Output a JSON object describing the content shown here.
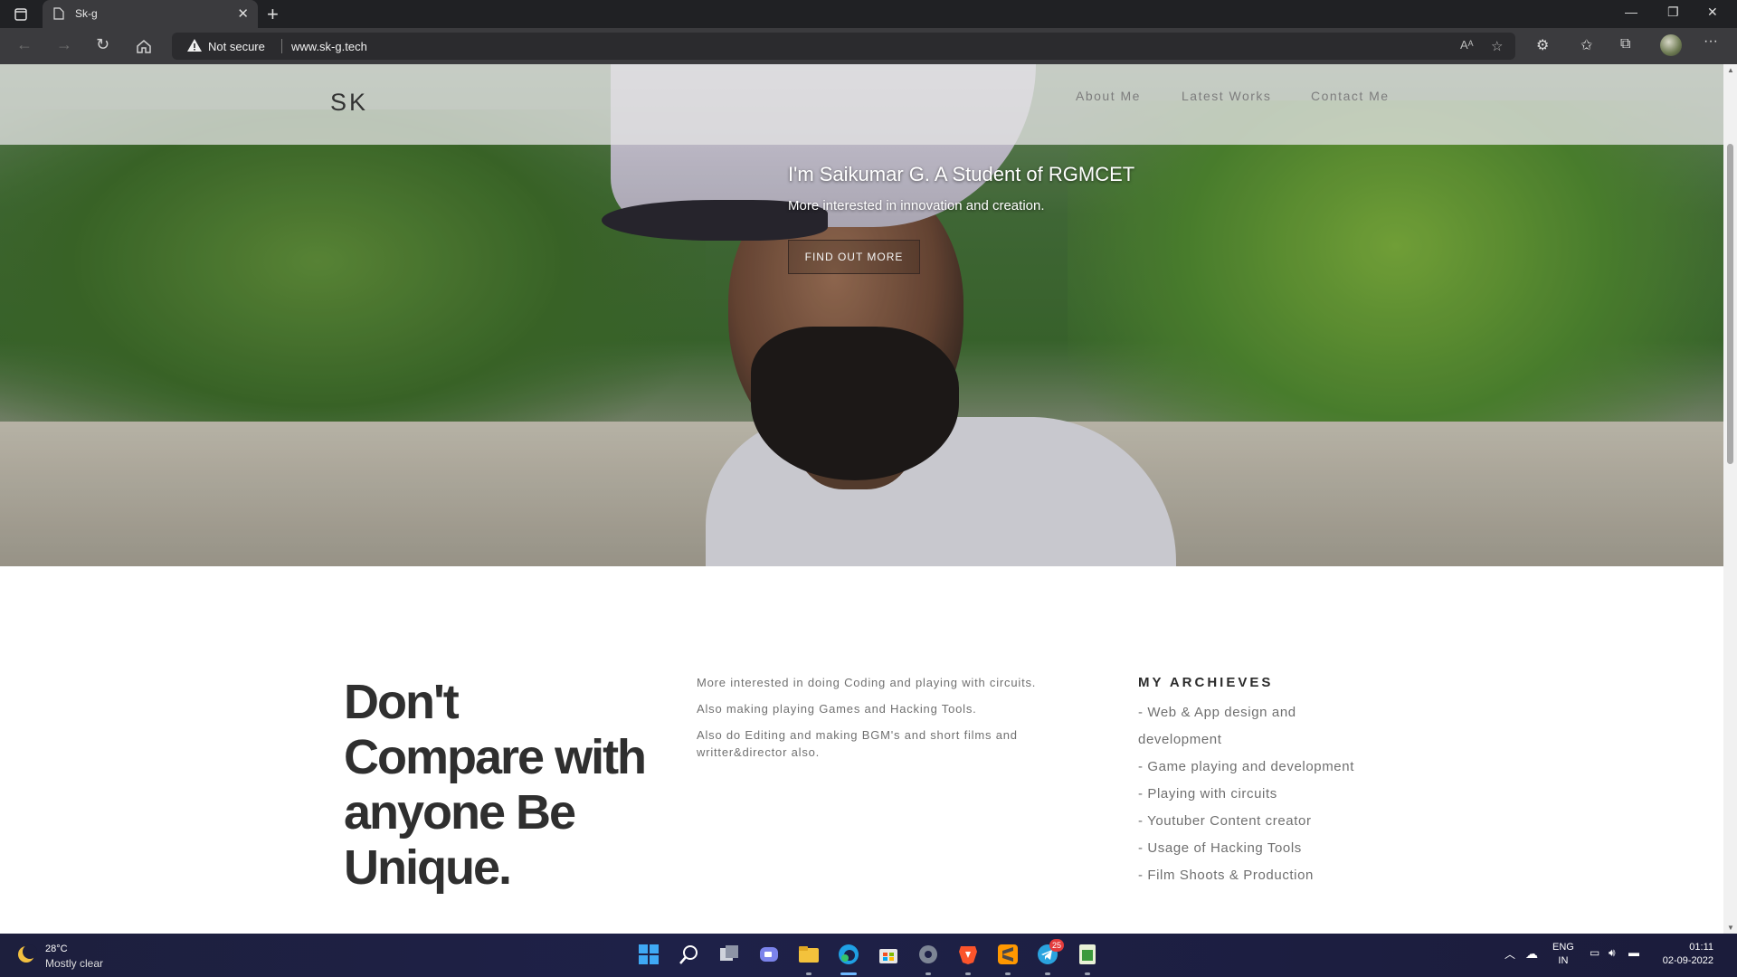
{
  "browser": {
    "tab_title": "Sk-g",
    "tab_close": "✕",
    "new_tab": "+",
    "security_label": "Not secure",
    "url": "www.sk-g.tech",
    "menu": "···",
    "window": {
      "minimize": "—",
      "restore": "❐",
      "close": "✕"
    }
  },
  "site": {
    "logo": "SK",
    "nav": [
      {
        "label": "About Me"
      },
      {
        "label": "Latest Works"
      },
      {
        "label": "Contact Me"
      }
    ],
    "hero": {
      "title": "I'm Saikumar G. A Student of RGMCET",
      "subtitle": "More interested in innovation and creation.",
      "button": "FIND OUT MORE"
    },
    "motto": {
      "lines": [
        "Don't",
        "Compare with",
        "anyone Be",
        "Unique."
      ]
    },
    "about_lines": [
      "More interested in doing Coding and playing with circuits.",
      "Also making playing Games and Hacking Tools.",
      "Also do Editing and making BGM's and short films and writter&director also."
    ],
    "archieves": {
      "title": "MY ARCHIEVES",
      "items": [
        "- Web & App design and development",
        "- Game playing and development",
        "- Playing with circuits",
        "- Youtuber Content creator",
        "- Usage of Hacking Tools",
        "- Film Shoots & Production"
      ]
    }
  },
  "taskbar": {
    "weather": {
      "temp": "28°C",
      "desc": "Mostly clear"
    },
    "telegram_badge": "25",
    "language": {
      "line1": "ENG",
      "line2": "IN"
    },
    "clock": {
      "time": "01:11",
      "date": "02-09-2022"
    }
  },
  "colors": {
    "browser_chrome": "#202124",
    "toolbar": "#3b3b3e",
    "taskbar": "#1e2148",
    "heading_text": "#2f2f2f"
  }
}
